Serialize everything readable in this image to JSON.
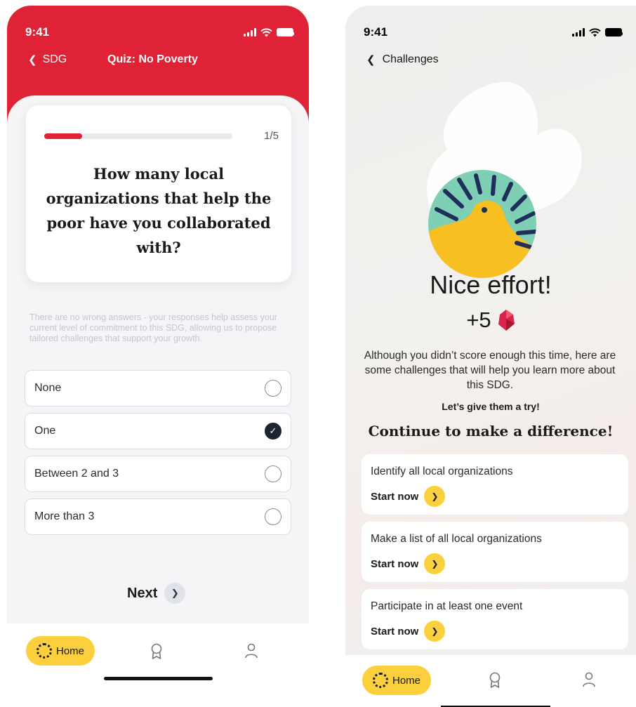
{
  "left": {
    "status": {
      "time": "9:41"
    },
    "nav": {
      "back_label": "SDG",
      "title": "Quiz: No Poverty"
    },
    "question": {
      "progress_text": "1/5",
      "progress_fraction": 0.2,
      "text": "How many local organizations that help the poor have you collaborated with?"
    },
    "helper_text": "There are no wrong answers - your responses help assess your current level of commitment to this SDG, allowing us to propose tailored challenges that support your growth.",
    "options": [
      {
        "label": "None",
        "selected": false
      },
      {
        "label": "One",
        "selected": true
      },
      {
        "label": "Between 2 and 3",
        "selected": false
      },
      {
        "label": "More than 3",
        "selected": false
      }
    ],
    "next_label": "Next",
    "tabbar": {
      "home_label": "Home"
    }
  },
  "right": {
    "status": {
      "time": "9:41"
    },
    "nav": {
      "back_label": "Challenges"
    },
    "result": {
      "title": "Nice effort!",
      "points": "+5",
      "text": "Although you didn’t score enough this time, here are some challenges that will help you learn more about this SDG.",
      "try_text": "Let’s give them a try!",
      "section_title": "Continue to make a difference!"
    },
    "challenges": [
      {
        "title": "Identify all local organizations",
        "action": "Start now"
      },
      {
        "title": "Make a list of all local organizations",
        "action": "Start now"
      },
      {
        "title": "Participate in at least one event",
        "action": "Start now"
      }
    ],
    "tabbar": {
      "home_label": "Home"
    }
  },
  "colors": {
    "brand_red": "#e02236",
    "accent_yellow": "#fbd03c",
    "mascot_teal": "#7ecfb4",
    "mascot_navy": "#1f2e5a",
    "gem": "#d9254a"
  },
  "icons": [
    "chevron-left-icon",
    "signal-icon",
    "wifi-icon",
    "battery-icon",
    "check-icon",
    "chevron-right-icon",
    "home-logo-icon",
    "award-icon",
    "profile-icon",
    "gem-icon",
    "bird-mascot-icon"
  ]
}
